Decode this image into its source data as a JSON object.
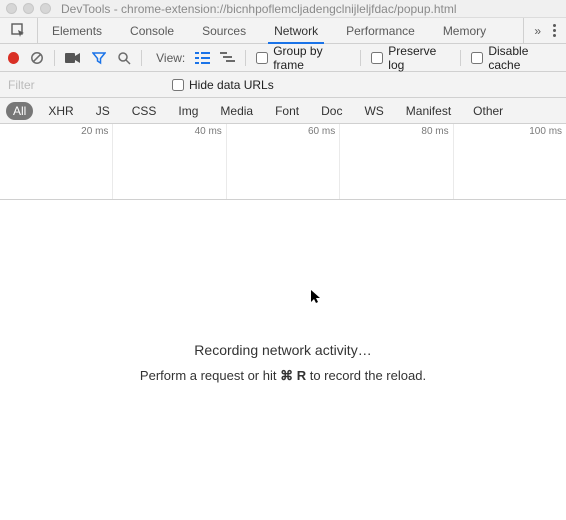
{
  "window": {
    "title": "DevTools - chrome-extension://bicnhpoflemcljadengclnijleljfdac/popup.html"
  },
  "tabs": {
    "items": [
      "Elements",
      "Console",
      "Sources",
      "Network",
      "Performance",
      "Memory"
    ],
    "active_index": 3
  },
  "toolbar": {
    "view_label": "View:",
    "group_by_frame": "Group by frame",
    "preserve_log": "Preserve log",
    "disable_cache": "Disable cache"
  },
  "filter": {
    "placeholder": "Filter",
    "hide_data_urls": "Hide data URLs"
  },
  "resource_types": {
    "items": [
      "All",
      "XHR",
      "JS",
      "CSS",
      "Img",
      "Media",
      "Font",
      "Doc",
      "WS",
      "Manifest",
      "Other"
    ],
    "active_index": 0
  },
  "timeline": {
    "ticks": [
      "20 ms",
      "40 ms",
      "60 ms",
      "80 ms",
      "100 ms"
    ]
  },
  "body": {
    "recording": "Recording network activity…",
    "hint_prefix": "Perform a request or hit ",
    "hint_key": "⌘ R",
    "hint_suffix": " to record the reload."
  }
}
